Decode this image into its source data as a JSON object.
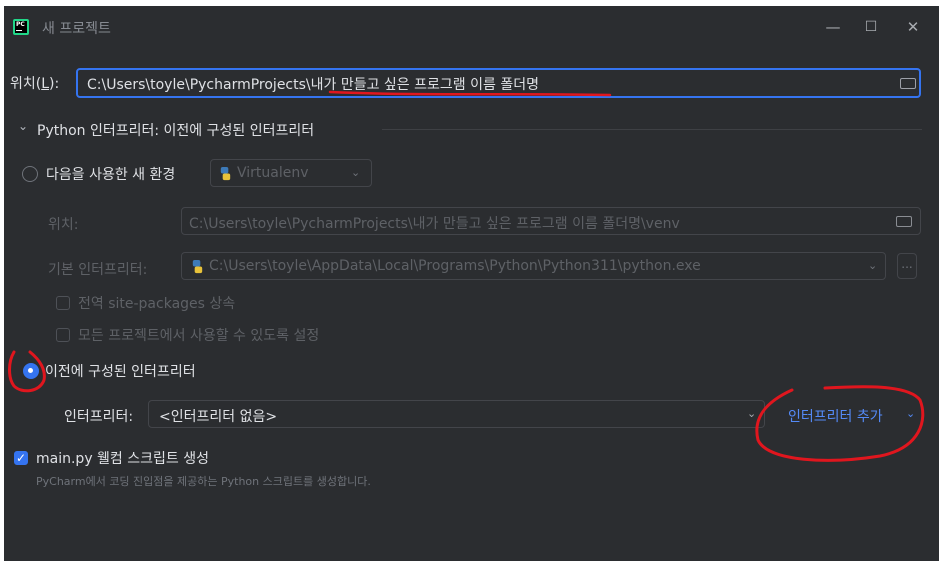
{
  "window": {
    "title": "새 프로젝트",
    "app_icon_text": "PC",
    "minimize_glyph": "—",
    "maximize_glyph": "☐",
    "close_glyph": "✕"
  },
  "location": {
    "label": "위치(L):",
    "value_prefix": "C:\\Users\\toyle\\PycharmProjects\\",
    "value_suffix": "내가 만들고 싶은 프로그램 이름 폴더명",
    "folder_icon": "folder-icon"
  },
  "section": {
    "chevron": "⌄",
    "title": "Python 인터프리터: 이전에 구성된 인터프리터"
  },
  "new_env": {
    "radio_label": "다음을 사용한 새 환경",
    "env_type": "Virtualenv",
    "location_label": "위치:",
    "location_value": "C:\\Users\\toyle\\PycharmProjects\\내가 만들고 싶은 프로그램 이름 폴더명\\venv",
    "base_interpreter_label": "기본 인터프리터:",
    "base_interpreter_value": "C:\\Users\\toyle\\AppData\\Local\\Programs\\Python\\Python311\\python.exe",
    "inherit_label": "전역 site-packages 상속",
    "share_label": "모든 프로젝트에서 사용할 수 있도록 설정",
    "more_button": "..."
  },
  "previous": {
    "radio_label": "이전에 구성된 인터프리터",
    "interpreter_label": "인터프리터:",
    "interpreter_value": "<인터프리터 없음>",
    "add_interpreter": "인터프리터 추가"
  },
  "welcome": {
    "checkbox_label": "main.py 웰컴 스크립트 생성",
    "checked": true,
    "description": "PyCharm에서 코딩 진입점을 제공하는 Python 스크립트를 생성합니다."
  },
  "colors": {
    "background": "#2b2d30",
    "accent": "#3574f0",
    "link": "#548af7",
    "annotation": "#e0161e"
  }
}
